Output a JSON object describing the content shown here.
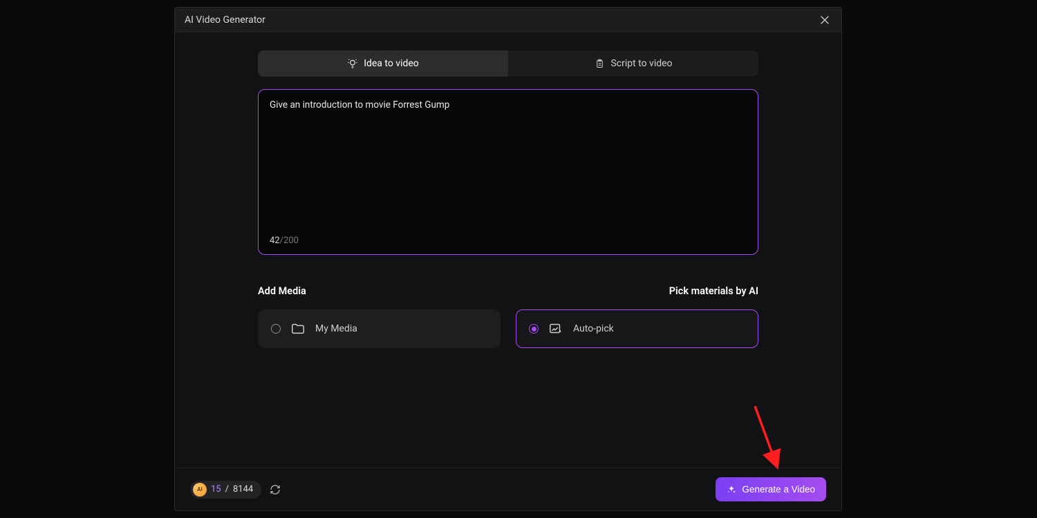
{
  "dialog": {
    "title": "AI Video Generator"
  },
  "tabs": {
    "idea": "Idea to video",
    "script": "Script to video"
  },
  "prompt": {
    "text": "Give an introduction to movie Forrest Gump",
    "count": "42",
    "max": "200"
  },
  "media": {
    "add_label": "Add Media",
    "pick_label": "Pick materials by AI",
    "my_media": "My Media",
    "auto_pick": "Auto-pick"
  },
  "footer": {
    "badge": "AI",
    "used": "15",
    "sep": "/",
    "total": "8144",
    "generate": "Generate a Video"
  }
}
